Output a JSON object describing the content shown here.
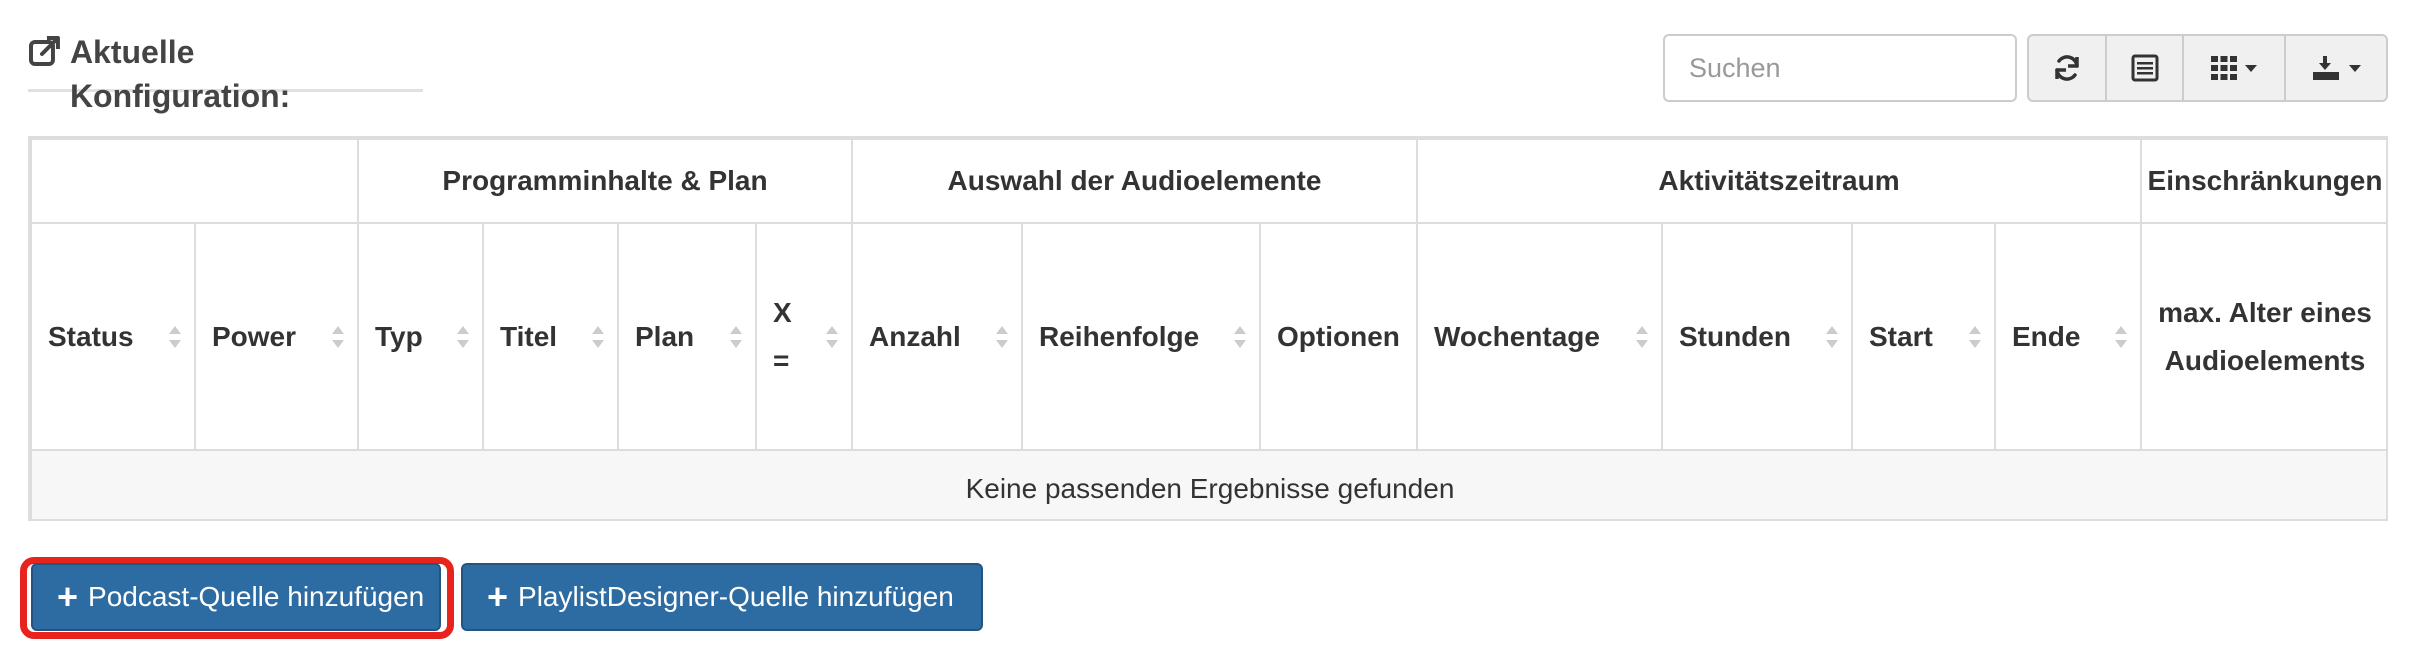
{
  "section": {
    "title": "Aktuelle Konfiguration:",
    "icon": "external-link-icon"
  },
  "toolbar": {
    "search_placeholder": "Suchen",
    "buttons": [
      {
        "name": "refresh-icon"
      },
      {
        "name": "list-view-icon"
      },
      {
        "name": "columns-icon",
        "dropdown": true
      },
      {
        "name": "export-icon",
        "dropdown": true
      }
    ]
  },
  "table": {
    "groups": {
      "empty": "",
      "program": "Programminhalte & Plan",
      "audio": "Auswahl der Audioelemente",
      "activity": "Aktivitätszeitraum",
      "restrictions": "Einschränkungen"
    },
    "columns": {
      "status": "Status",
      "power": "Power",
      "typ": "Typ",
      "titel": "Titel",
      "plan": "Plan",
      "x": "X =",
      "anzahl": "Anzahl",
      "reihenfolge": "Reihenfolge",
      "optionen": "Optionen",
      "wochentage": "Wochentage",
      "stunden": "Stunden",
      "start": "Start",
      "ende": "Ende",
      "maxalter": "max. Alter eines Audioelements"
    },
    "empty_message": "Keine passenden Ergebnisse gefunden"
  },
  "actions": {
    "add_podcast": "Podcast-Quelle hinzufügen",
    "add_playlistdesigner": "PlaylistDesigner-Quelle hinzufügen"
  },
  "colors": {
    "primary": "#2d6ca2",
    "highlight": "#e8231d",
    "border": "#dddddd"
  }
}
